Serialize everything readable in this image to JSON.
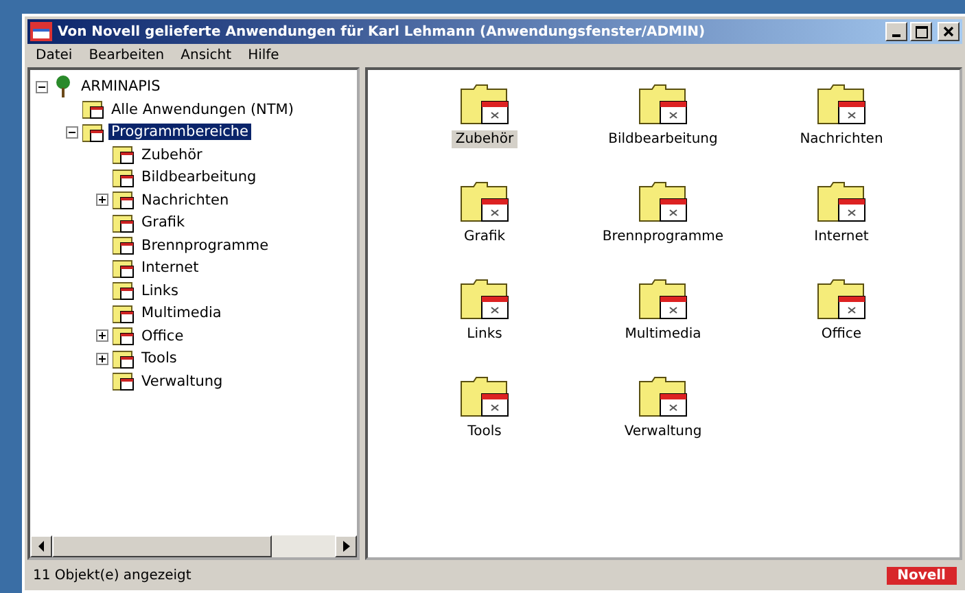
{
  "window": {
    "title": "Von Novell gelieferte Anwendungen für Karl Lehmann (Anwendungsfenster/ADMIN)"
  },
  "menu": [
    "Datei",
    "Bearbeiten",
    "Ansicht",
    "Hilfe"
  ],
  "tree": [
    {
      "label": "ARMINAPIS",
      "expanded": true,
      "selected": false,
      "kind": "root",
      "children": [
        {
          "label": "Alle Anwendungen (NTM)",
          "selected": false,
          "kind": "folder"
        },
        {
          "label": "Programmbereiche",
          "expanded": true,
          "selected": true,
          "kind": "folder",
          "children": [
            {
              "label": "Zubehör",
              "selected": false,
              "kind": "folder"
            },
            {
              "label": "Bildbearbeitung",
              "selected": false,
              "kind": "folder"
            },
            {
              "label": "Nachrichten",
              "expanded": false,
              "selected": false,
              "kind": "folder"
            },
            {
              "label": "Grafik",
              "selected": false,
              "kind": "folder"
            },
            {
              "label": "Brennprogramme",
              "selected": false,
              "kind": "folder"
            },
            {
              "label": "Internet",
              "selected": false,
              "kind": "folder"
            },
            {
              "label": "Links",
              "selected": false,
              "kind": "folder"
            },
            {
              "label": "Multimedia",
              "selected": false,
              "kind": "folder"
            },
            {
              "label": "Office",
              "expanded": false,
              "selected": false,
              "kind": "folder"
            },
            {
              "label": "Tools",
              "expanded": false,
              "selected": false,
              "kind": "folder"
            },
            {
              "label": "Verwaltung",
              "selected": false,
              "kind": "folder"
            }
          ]
        }
      ]
    }
  ],
  "icons": [
    {
      "label": "Zubehör",
      "selected": true
    },
    {
      "label": "Bildbearbeitung",
      "selected": false
    },
    {
      "label": "Nachrichten",
      "selected": false
    },
    {
      "label": "Grafik",
      "selected": false
    },
    {
      "label": "Brennprogramme",
      "selected": false
    },
    {
      "label": "Internet",
      "selected": false
    },
    {
      "label": "Links",
      "selected": false
    },
    {
      "label": "Multimedia",
      "selected": false
    },
    {
      "label": "Office",
      "selected": false
    },
    {
      "label": "Tools",
      "selected": false
    },
    {
      "label": "Verwaltung",
      "selected": false
    }
  ],
  "status_bar": {
    "text": "11 Objekt(e) angezeigt",
    "badge": "Novell"
  }
}
